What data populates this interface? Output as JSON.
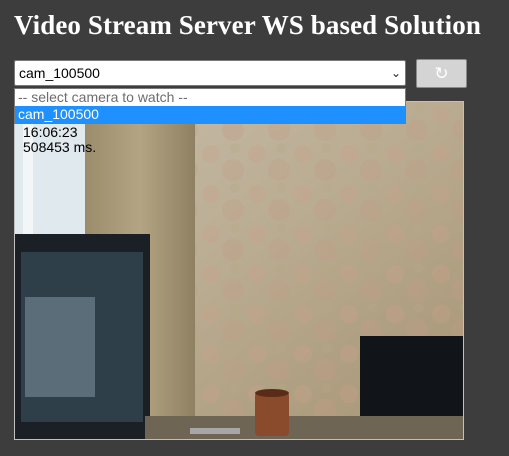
{
  "page": {
    "title": "Video Stream Server WS based Solution"
  },
  "camera_select": {
    "value": "cam_100500",
    "options": [
      "-- select camera to watch --",
      "cam_100500"
    ],
    "selected_index": 1
  },
  "refresh_button": {
    "icon": "refresh-icon",
    "glyph": "↻"
  },
  "video": {
    "time": "16:06:23",
    "latency": "508453 ms."
  },
  "colors": {
    "background": "#3d3d3d",
    "highlight": "#1e90ff"
  }
}
